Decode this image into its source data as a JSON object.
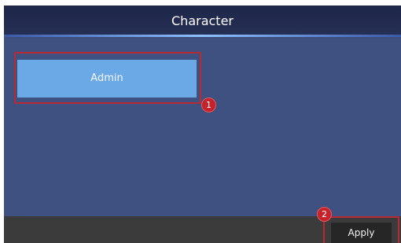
{
  "header": {
    "title": "Character"
  },
  "roles": {
    "items": [
      {
        "label": "Admin"
      }
    ]
  },
  "annotations": {
    "badge_1": "1",
    "badge_2": "2",
    "highlight_color": "#b52a33"
  },
  "footer": {
    "apply_label": "Apply"
  },
  "colors": {
    "title_bar": "#1e2748",
    "content_bg": "#3f5180",
    "role_item_bg": "#6aa9e5",
    "footer_bg": "#3b3b3b",
    "badge": "#c4232c"
  }
}
